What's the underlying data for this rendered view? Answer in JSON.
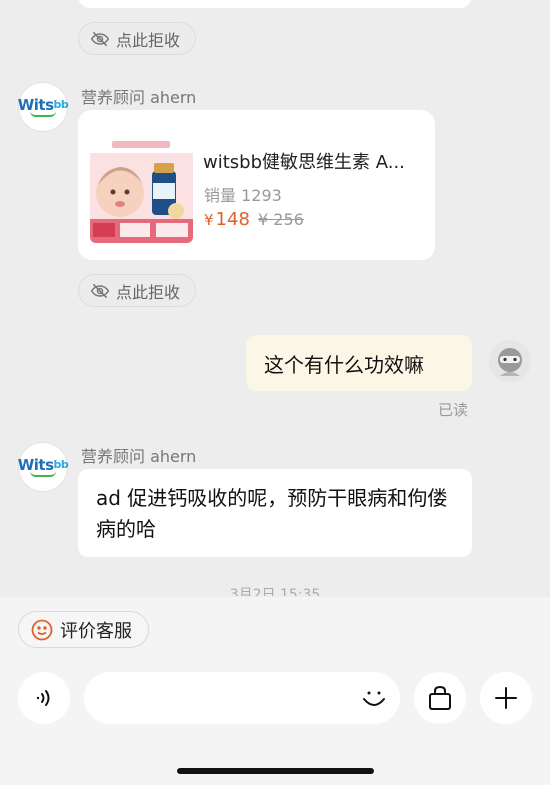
{
  "reject_label": "点此拒收",
  "advisor": {
    "name": "营养顾问 ahern",
    "logo_text": "Wits",
    "logo_text_sup": "bb"
  },
  "product": {
    "title": "witsbb健敏思维生素 A...",
    "sales": "销量 1293",
    "price_symbol": "¥",
    "price": "148",
    "original_price": "¥ 256"
  },
  "my_message": "这个有什么功效嘛",
  "read_status": "已读",
  "reply_message": "ad 促进钙吸收的呢，预防干眼病和佝偻病的哈",
  "timestamp": "3月2日 15:35",
  "rate_button": "评价客服",
  "colors": {
    "price": "#e0602a",
    "my_bubble": "#fbf6e6",
    "background": "#ededed",
    "brand_blue": "#1e6fb8"
  },
  "icons": {
    "reject": "eye-off-icon",
    "rate": "smile-icon",
    "voice": "voice-icon",
    "emoji": "emoji-icon",
    "shop": "shopping-bag-icon",
    "plus": "plus-icon"
  }
}
